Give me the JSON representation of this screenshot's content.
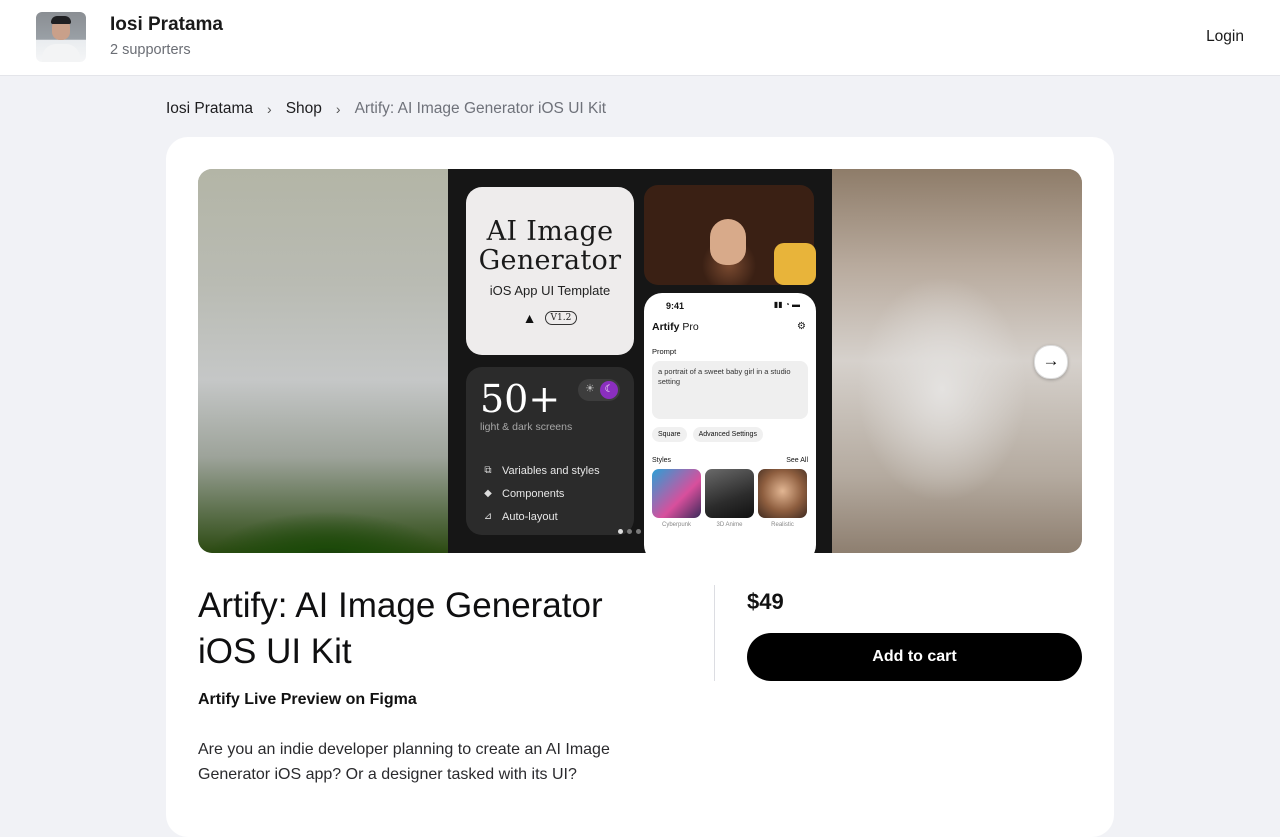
{
  "header": {
    "creator_name": "Iosi Pratama",
    "supporters": "2 supporters",
    "login_label": "Login"
  },
  "breadcrumb": {
    "items": [
      "Iosi Pratama",
      "Shop"
    ],
    "current": "Artify: AI Image Generator iOS UI Kit"
  },
  "gallery": {
    "cover": {
      "title_line1": "AI Image",
      "title_line2": "Generator",
      "subtitle": "iOS App UI Template",
      "version": "V1.2",
      "screens_count": "50+",
      "screens_label": "light & dark screens",
      "features": [
        "Variables and styles",
        "Components",
        "Auto-layout"
      ],
      "phone": {
        "time": "9:41",
        "brand": "Artify",
        "brand_suffix": "Pro",
        "prompt_label": "Prompt",
        "prompt_text": "a portrait of a sweet baby girl in a studio setting",
        "chips": [
          "Square",
          "Advanced Settings"
        ],
        "styles_label": "Styles",
        "see_all": "See All",
        "style_names": [
          "Cyberpunk",
          "3D Anime",
          "Realistic"
        ]
      }
    },
    "slide_dots": 3,
    "active_dot": 0
  },
  "product": {
    "title": "Artify: AI Image Generator iOS UI Kit",
    "subtitle": "Artify Live Preview on Figma",
    "description": "Are you an indie developer planning to create an AI Image Generator iOS app? Or a designer tasked with its UI?",
    "price": "$49",
    "cart_label": "Add to cart"
  },
  "colors": {
    "accent": "#000000",
    "page_bg": "#f1f2f6",
    "moon_toggle": "#8b2fbf",
    "apple_badge": "#e8b43a"
  },
  "icons": [
    "chevron-right-icon",
    "arrow-right-icon",
    "apple-icon",
    "figma-icon",
    "sun-icon",
    "moon-icon"
  ]
}
